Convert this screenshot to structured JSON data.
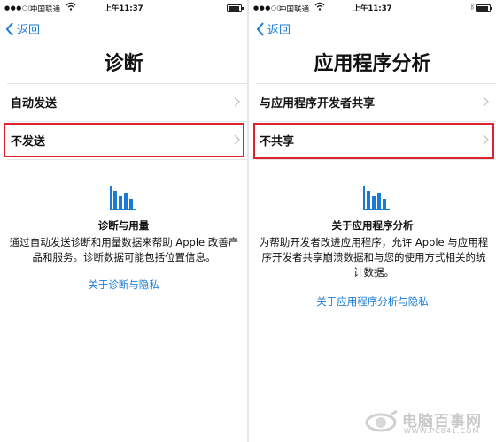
{
  "left": {
    "status": {
      "signal": "●●●○○",
      "carrier": "中国联通",
      "time": "上午11:37"
    },
    "back_label": "返回",
    "title": "诊断",
    "rows": [
      {
        "label": "自动发送"
      },
      {
        "label": "不发送",
        "highlighted": true
      }
    ],
    "info": {
      "title": "诊断与用量",
      "body": "通过自动发送诊断和用量数据来帮助 Apple 改善产品和服务。诊断数据可能包括位置信息。",
      "link": "关于诊断与隐私"
    }
  },
  "right": {
    "status": {
      "signal": "●●●○○",
      "carrier": "中国联通",
      "time": "上午11:37",
      "bluetooth": "ᛒ"
    },
    "back_label": "返回",
    "title": "应用程序分析",
    "rows": [
      {
        "label": "与应用程序开发者共享"
      },
      {
        "label": "不共享",
        "highlighted": true
      }
    ],
    "info": {
      "title": "关于应用程序分析",
      "body": "为帮助开发者改进应用程序，允许 Apple 与应用程序开发者共享崩溃数据和与您的使用方式相关的统计数据。",
      "link": "关于应用程序分析与隐私"
    }
  },
  "watermark": {
    "name": "电脑百事网",
    "url": "WWW.PC841.COM"
  },
  "colors": {
    "link_blue": "#1a7bd6",
    "highlight_red": "#d9232d"
  }
}
